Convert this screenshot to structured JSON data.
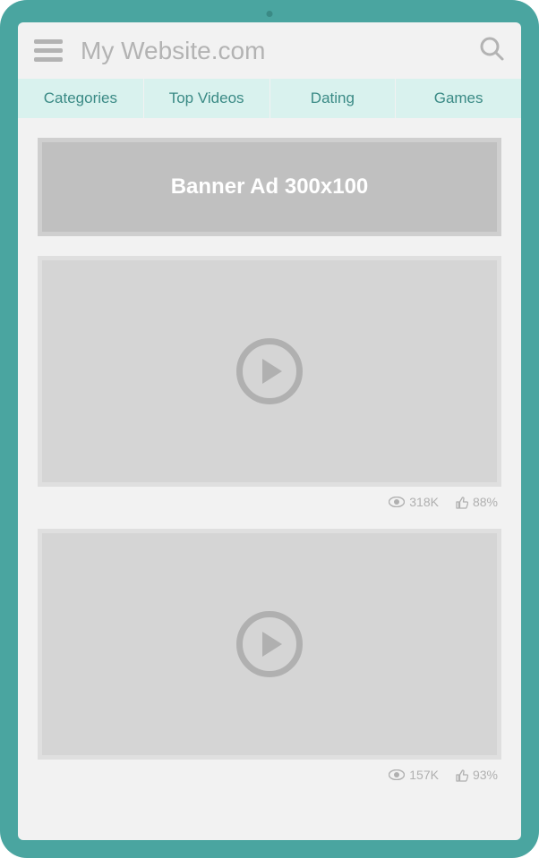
{
  "header": {
    "title": "My Website.com"
  },
  "tabs": [
    "Categories",
    "Top Videos",
    "Dating",
    "Games"
  ],
  "banner": {
    "text": "Banner Ad 300x100"
  },
  "videos": [
    {
      "views": "318K",
      "rating": "88%"
    },
    {
      "views": "157K",
      "rating": "93%"
    }
  ]
}
